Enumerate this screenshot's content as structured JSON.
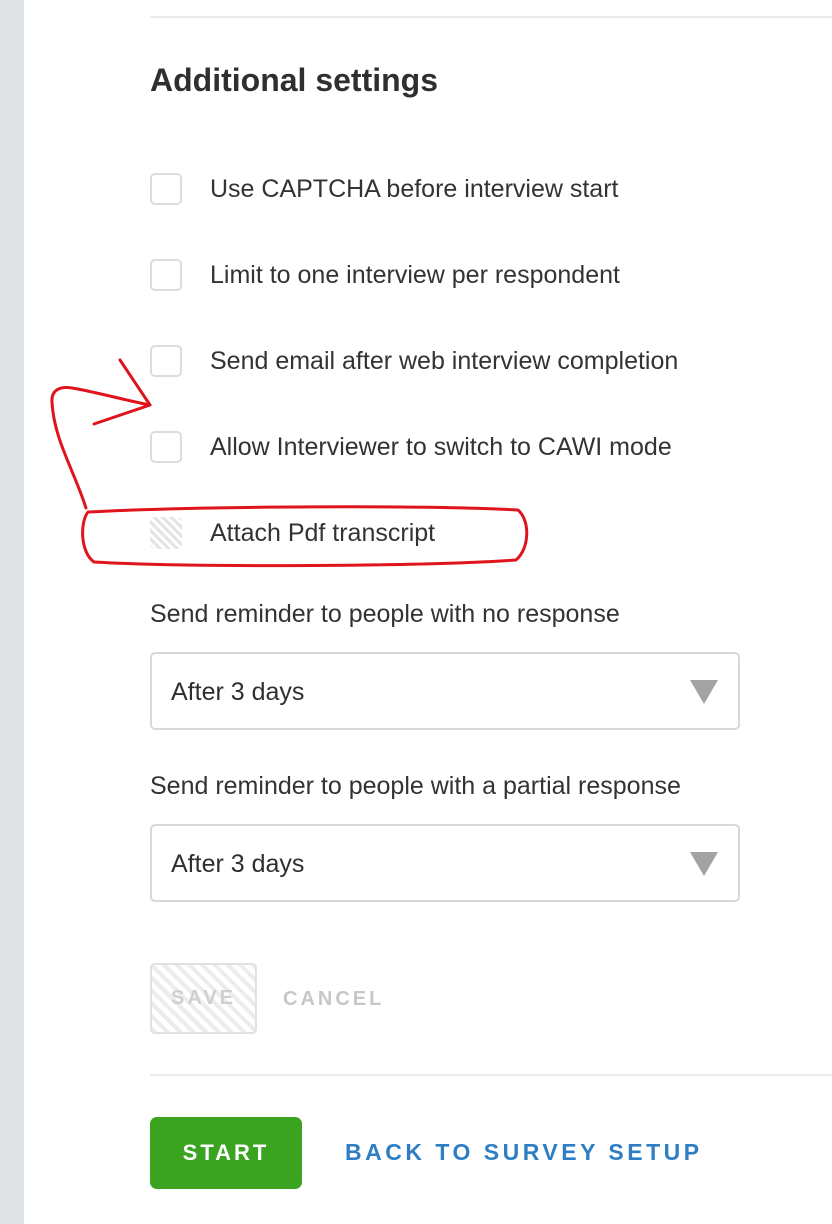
{
  "settings": {
    "title": "Additional settings",
    "options": [
      {
        "label": "Use CAPTCHA before interview start",
        "checked": false,
        "disabled": false
      },
      {
        "label": "Limit to one interview per respondent",
        "checked": false,
        "disabled": false
      },
      {
        "label": "Send email after web interview completion",
        "checked": false,
        "disabled": false
      },
      {
        "label": "Allow Interviewer to switch to CAWI mode",
        "checked": false,
        "disabled": false
      },
      {
        "label": "Attach Pdf transcript",
        "checked": false,
        "disabled": true
      }
    ],
    "reminder_no_response": {
      "label": "Send reminder to people with no response",
      "value": "After 3 days"
    },
    "reminder_partial_response": {
      "label": "Send reminder to people with a partial response",
      "value": "After 3 days"
    },
    "save_label": "SAVE",
    "cancel_label": "CANCEL"
  },
  "footer": {
    "start_label": "START",
    "back_label": "BACK TO SURVEY SETUP"
  },
  "colors": {
    "primary_green": "#3aa31f",
    "link_blue": "#2f7ec4",
    "annotation_red": "#e0141c"
  },
  "annotation": {
    "icon": "red-arrow-and-circle-highlight"
  }
}
